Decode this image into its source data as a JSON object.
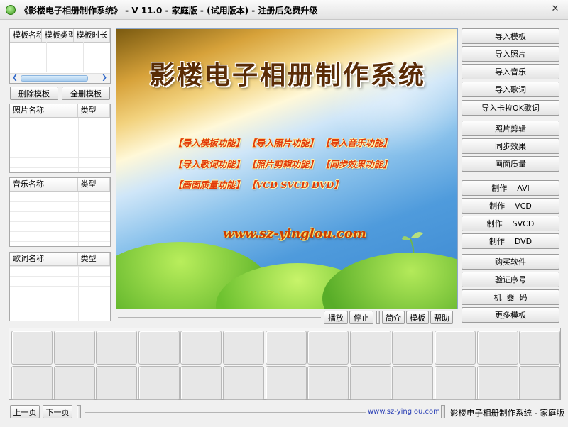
{
  "window": {
    "title": "《影楼电子相册制作系统》 - V 11.0 - 家庭版 - (试用版本) - 注册后免费升级"
  },
  "template_list": {
    "columns": [
      "模板名称",
      "模板类型",
      "模板时长"
    ]
  },
  "template_buttons": {
    "delete": "删除模板",
    "delete_all": "全删模板"
  },
  "photo_list": {
    "columns": [
      "照片名称",
      "类型"
    ]
  },
  "music_list": {
    "columns": [
      "音乐名称",
      "类型"
    ]
  },
  "lyrics_list": {
    "columns": [
      "歌词名称",
      "类型"
    ]
  },
  "preview": {
    "title": "影楼电子相册制作系统",
    "features_row1": [
      "【导入模板功能】",
      "【导入照片功能】",
      "【导入音乐功能】"
    ],
    "features_row2": [
      "【导入歌词功能】",
      "【照片剪辑功能】",
      "【同步效果功能】"
    ],
    "features_row3": [
      "【画面质量功能】",
      "【VCD SVCD DVD】"
    ],
    "url": "www.sz-yinglou.com"
  },
  "playback": {
    "play": "播放",
    "stop": "停止",
    "intro": "简介",
    "template": "模板",
    "help": "帮助"
  },
  "right_buttons": [
    "导入模板",
    "导入照片",
    "导入音乐",
    "导入歌词",
    "导入卡拉OK歌词",
    "照片剪辑",
    "同步效果",
    "画面质量",
    "制作    AVI",
    "制作    VCD",
    "制作    SVCD",
    "制作    DVD",
    "购买软件",
    "验证序号",
    "机  器  码",
    "更多模板"
  ],
  "footer": {
    "prev": "上一页",
    "next": "下一页",
    "url": "www.sz-yinglou.com",
    "product": "影楼电子相册制作系统 - 家庭版"
  },
  "colors": {
    "accent_blue": "#4f9bdc",
    "url_blue": "#2a3fb5",
    "feature_red": "#e23a08"
  }
}
